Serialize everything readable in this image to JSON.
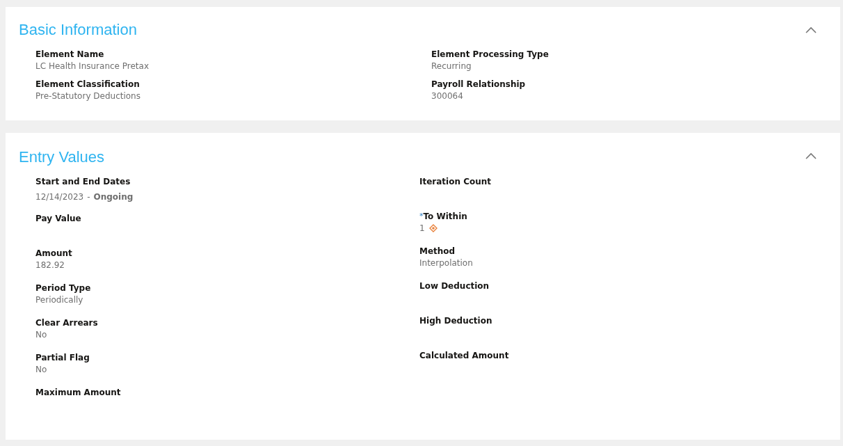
{
  "sections": [
    {
      "title": "Basic Information",
      "expanded": true,
      "columns": [
        [
          {
            "label": "Element Name",
            "value": "LC Health Insurance Pretax"
          },
          {
            "label": "Element Classification",
            "value": "Pre-Statutory Deductions"
          }
        ],
        [
          {
            "label": "Element Processing Type",
            "value": "Recurring"
          },
          {
            "label": "Payroll Relationship",
            "value": "300064"
          }
        ]
      ]
    },
    {
      "title": "Entry Values",
      "expanded": true,
      "columns": [
        [
          {
            "label": "Start and End Dates",
            "kind": "dates",
            "start": "12/14/2023",
            "separator": "-",
            "end": "Ongoing"
          },
          {
            "label": "Pay Value"
          },
          {
            "label": "Amount",
            "value": "182.92"
          },
          {
            "label": "Period Type",
            "value": "Periodically"
          },
          {
            "label": "Clear Arrears",
            "value": "No"
          },
          {
            "label": "Partial Flag",
            "value": "No"
          },
          {
            "label": "Maximum Amount"
          }
        ],
        [
          {
            "label": "Iteration Count"
          },
          {
            "label": "To Within",
            "required_mark": "*",
            "value": "1",
            "warning": true
          },
          {
            "label": "Method",
            "value": "Interpolation"
          },
          {
            "label": "Low Deduction"
          },
          {
            "label": "High Deduction"
          },
          {
            "label": "Calculated Amount"
          }
        ]
      ]
    }
  ]
}
